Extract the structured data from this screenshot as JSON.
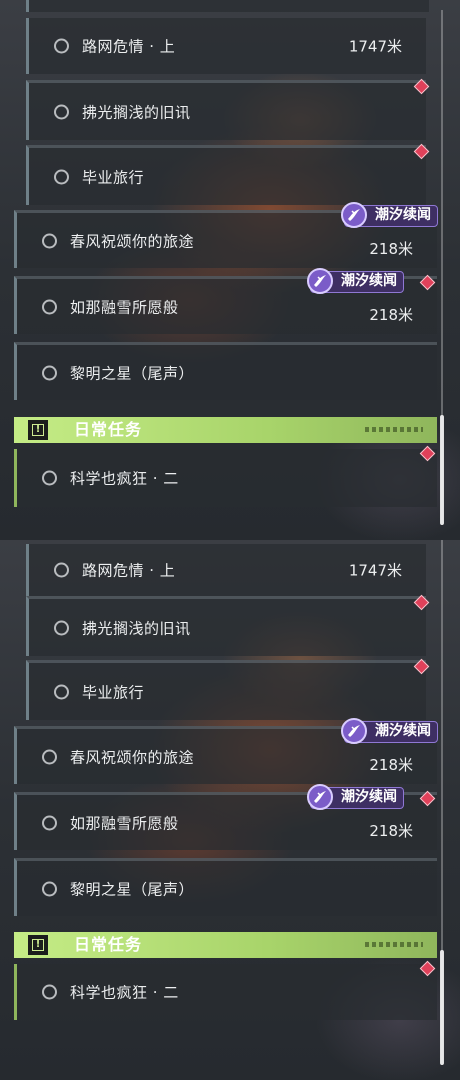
{
  "panels": [
    {
      "quests": [
        {
          "name": "路网危情 · 上",
          "distance": "1747米"
        },
        {
          "name": "拂光搁浅的旧讯",
          "distance": ""
        },
        {
          "name": "毕业旅行",
          "distance": ""
        },
        {
          "name": "春风祝颂你的旅途",
          "distance": "218米",
          "badge": "潮汐续闻"
        },
        {
          "name": "如那融雪所愿般",
          "distance": "218米",
          "badge": "潮汐续闻"
        },
        {
          "name": "黎明之星（尾声）",
          "distance": ""
        }
      ],
      "category": {
        "title": "日常任务",
        "icon": "exclamation-box-icon"
      },
      "daily_quests": [
        {
          "name": "科学也疯狂 · 二",
          "distance": ""
        }
      ]
    },
    {
      "quests": [
        {
          "name": "路网危情 · 上",
          "distance": "1747米"
        },
        {
          "name": "拂光搁浅的旧讯",
          "distance": ""
        },
        {
          "name": "毕业旅行",
          "distance": ""
        },
        {
          "name": "春风祝颂你的旅途",
          "distance": "218米",
          "badge": "潮汐续闻"
        },
        {
          "name": "如那融雪所愿般",
          "distance": "218米",
          "badge": "潮汐续闻"
        },
        {
          "name": "黎明之星（尾声）",
          "distance": ""
        }
      ],
      "category": {
        "title": "日常任务",
        "icon": "exclamation-box-icon"
      },
      "daily_quests": [
        {
          "name": "科学也疯狂 · 二",
          "distance": ""
        }
      ]
    }
  ],
  "colors": {
    "category_green": "#c5ec86",
    "badge_purple": "#3e2f63",
    "pin_red": "#e0415a",
    "item_bg": "#282c31"
  }
}
